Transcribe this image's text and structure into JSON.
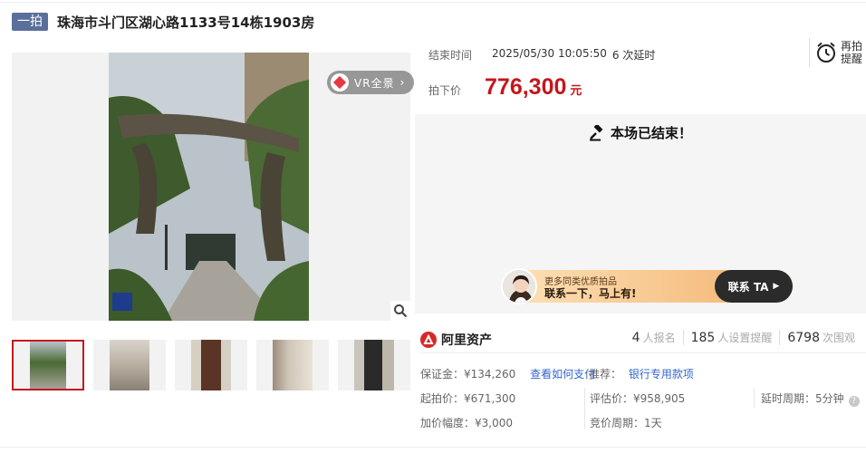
{
  "header": {
    "round_badge": "一拍",
    "title": "珠海市斗门区湖心路1133号14栋1903房"
  },
  "gallery": {
    "vr_label": "VR全景",
    "vr_arrow": "›",
    "thumb_count": 5,
    "active_thumb": 1
  },
  "auction": {
    "end_label": "结束时间",
    "end_time": "2025/05/30 10:05:50",
    "delay_info": "6 次延时",
    "remind_line1": "再拍",
    "remind_line2": "提醒",
    "price_label": "拍下价",
    "price_value": "776,300",
    "price_unit": "元",
    "ended_text": "本场已结束！"
  },
  "promo": {
    "small_text": "更多同类优质拍品",
    "big_text": "联系一下，马上有!",
    "button_label": "联系 TA"
  },
  "platform": {
    "name": "阿里资产"
  },
  "stats": [
    {
      "num": "4",
      "label": "人报名"
    },
    {
      "num": "185",
      "label": "人设置提醒"
    },
    {
      "num": "6798",
      "label": "次围观"
    }
  ],
  "details": {
    "deposit": "保证金：¥134,260",
    "deposit_link": "查看如何支付",
    "recommend_label": "推荐：",
    "recommend_link": "银行专用款项",
    "start_price": "起拍价：¥671,300",
    "assess_price": "评估价：¥958,905",
    "delay_period": "延时周期：5分钟",
    "increment": "加价幅度：¥3,000",
    "bid_period": "竞价周期：1天"
  },
  "colors": {
    "accent_red": "#c4161c",
    "link_blue": "#3366cc",
    "badge_blue": "#5a6f9a"
  }
}
